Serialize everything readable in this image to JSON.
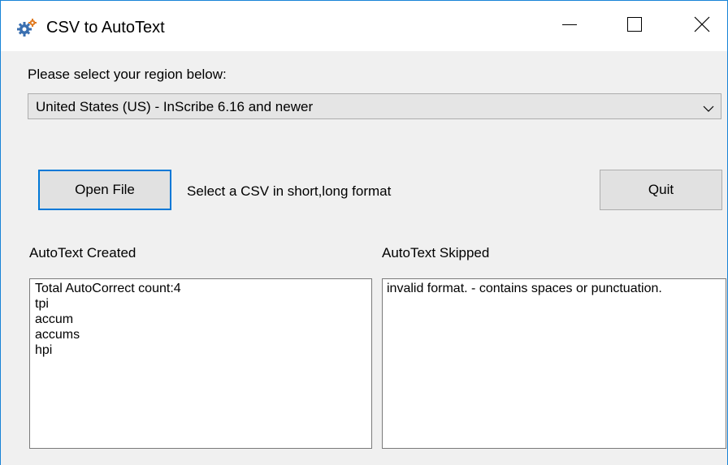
{
  "window": {
    "title": "CSV to AutoText",
    "icons": {
      "app": "gear-icon",
      "minimize": "minimize-icon",
      "maximize": "maximize-icon",
      "close": "close-icon"
    }
  },
  "region": {
    "label": "Please select your region below:",
    "selected": "United States (US) - InScribe 6.16 and newer"
  },
  "actions": {
    "open_label": "Open File",
    "hint": "Select a CSV in short,long format",
    "quit_label": "Quit"
  },
  "created": {
    "label": "AutoText Created",
    "lines": [
      "Total AutoCorrect count:4",
      "tpi",
      "accum",
      "accums",
      "hpi"
    ]
  },
  "skipped": {
    "label": "AutoText Skipped",
    "lines": [
      "invalid format. - contains spaces or punctuation."
    ]
  },
  "colors": {
    "accent": "#0078d7",
    "window_border": "#1883d7",
    "background": "#f0f0f0"
  }
}
